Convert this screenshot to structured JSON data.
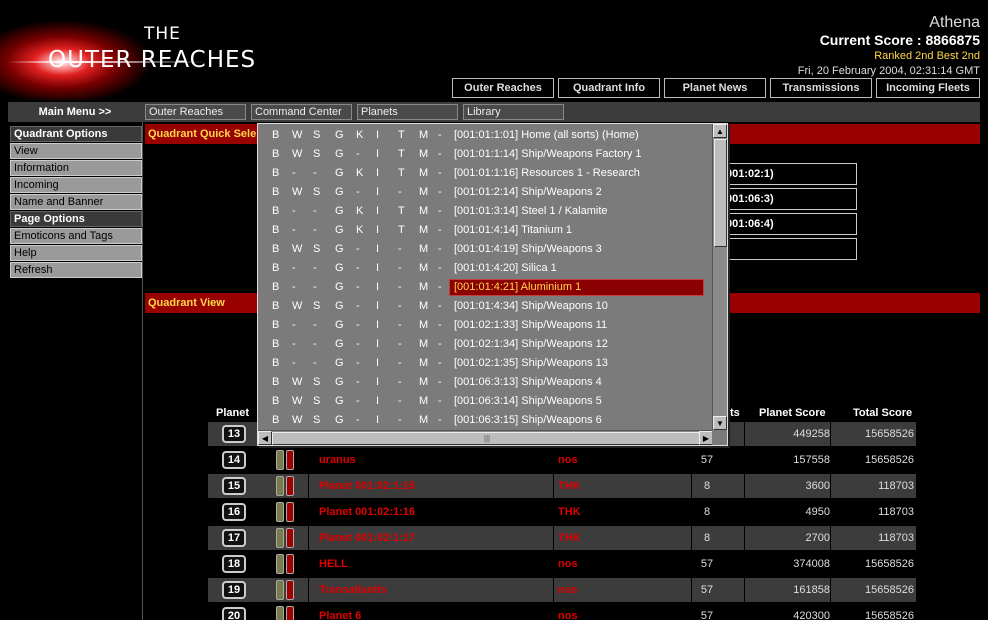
{
  "logo": {
    "the": "THE",
    "name": "OUTER REACHES"
  },
  "user": {
    "name": "Athena",
    "score": "Current Score : 8866875",
    "ranked": "Ranked 2nd Best 2nd",
    "datetime": "Fri, 20 February 2004, 02:31:14 GMT"
  },
  "top_nav": [
    "Outer Reaches",
    "Quadrant Info",
    "Planet News",
    "Transmissions",
    "Incoming Fleets"
  ],
  "menubar": {
    "main_menu": "Main Menu >>",
    "items": [
      "Outer Reaches",
      "Command Center",
      "Planets",
      "Library"
    ]
  },
  "sidebar": {
    "quadrant_options": "Quadrant Options",
    "quadrant_items": [
      "View",
      "Information",
      "Incoming",
      "Name and Banner"
    ],
    "page_options": "Page Options",
    "page_items": [
      "Emoticons and Tags",
      "Help",
      "Refresh"
    ]
  },
  "sections": {
    "quick_select": "Quadrant Quick Sele",
    "quadrant_view": "Quadrant View"
  },
  "quick_select_boxes": [
    "001:02:1)",
    "001:06:3)",
    "001:06:4)",
    ""
  ],
  "dropdown": {
    "selected_index": 8,
    "items": [
      {
        "f": [
          "B",
          "W",
          "S",
          "G",
          "K",
          "I",
          "T",
          "M",
          "-"
        ],
        "label": "[001:01:1:01] Home (all sorts) (Home)"
      },
      {
        "f": [
          "B",
          "W",
          "S",
          "G",
          "-",
          "I",
          "T",
          "M",
          "-"
        ],
        "label": "[001:01:1:14] Ship/Weapons Factory 1"
      },
      {
        "f": [
          "B",
          "-",
          "-",
          "G",
          "K",
          "I",
          "T",
          "M",
          "-"
        ],
        "label": "[001:01:1:16] Resources 1 - Research"
      },
      {
        "f": [
          "B",
          "W",
          "S",
          "G",
          "-",
          "I",
          "-",
          "M",
          "-"
        ],
        "label": "[001:01:2:14] Ship/Weapons 2"
      },
      {
        "f": [
          "B",
          "-",
          "-",
          "G",
          "K",
          "I",
          "T",
          "M",
          "-"
        ],
        "label": "[001:01:3:14] Steel 1 / Kalamite"
      },
      {
        "f": [
          "B",
          "-",
          "-",
          "G",
          "K",
          "I",
          "T",
          "M",
          "-"
        ],
        "label": "[001:01:4:14] Titanium 1"
      },
      {
        "f": [
          "B",
          "W",
          "S",
          "G",
          "-",
          "I",
          "-",
          "M",
          "-"
        ],
        "label": "[001:01:4:19] Ship/Weapons 3"
      },
      {
        "f": [
          "B",
          "-",
          "-",
          "G",
          "-",
          "I",
          "-",
          "M",
          "-"
        ],
        "label": "[001:01:4:20] Silica 1"
      },
      {
        "f": [
          "B",
          "-",
          "-",
          "G",
          "-",
          "I",
          "-",
          "M",
          "-"
        ],
        "label": "[001:01:4:21] Aluminium 1"
      },
      {
        "f": [
          "B",
          "W",
          "S",
          "G",
          "-",
          "I",
          "-",
          "M",
          "-"
        ],
        "label": "[001:01:4:34] Ship/Weapons 10"
      },
      {
        "f": [
          "B",
          "-",
          "-",
          "G",
          "-",
          "I",
          "-",
          "M",
          "-"
        ],
        "label": "[001:02:1:33] Ship/Weapons 11"
      },
      {
        "f": [
          "B",
          "-",
          "-",
          "G",
          "-",
          "I",
          "-",
          "M",
          "-"
        ],
        "label": "[001:02:1:34] Ship/Weapons 12"
      },
      {
        "f": [
          "B",
          "-",
          "-",
          "G",
          "-",
          "I",
          "-",
          "M",
          "-"
        ],
        "label": "[001:02:1:35] Ship/Weapons 13"
      },
      {
        "f": [
          "B",
          "W",
          "S",
          "G",
          "-",
          "I",
          "-",
          "M",
          "-"
        ],
        "label": "[001:06:3:13] Ship/Weapons 4"
      },
      {
        "f": [
          "B",
          "W",
          "S",
          "G",
          "-",
          "I",
          "-",
          "M",
          "-"
        ],
        "label": "[001:06:3:14] Ship/Weapons 5"
      },
      {
        "f": [
          "B",
          "W",
          "S",
          "G",
          "-",
          "I",
          "-",
          "M",
          "-"
        ],
        "label": "[001:06:3:15] Ship/Weapons 6"
      }
    ]
  },
  "table": {
    "headers": {
      "planet": "Planet",
      "rank_partial": "ts",
      "planet_score": "Planet Score",
      "total_score": "Total Score"
    },
    "rows": [
      {
        "num": "13",
        "name": "",
        "owner": "",
        "rank": "",
        "planet_score": "449258",
        "total_score": "15658526"
      },
      {
        "num": "14",
        "name": "uranus",
        "owner": "nos",
        "rank": "57",
        "planet_score": "157558",
        "total_score": "15658526"
      },
      {
        "num": "15",
        "name": "Planet 001:02:1:15",
        "owner": "THK",
        "rank": "8",
        "planet_score": "3600",
        "total_score": "118703"
      },
      {
        "num": "16",
        "name": "Planet 001:02:1:16",
        "owner": "THK",
        "rank": "8",
        "planet_score": "4950",
        "total_score": "118703"
      },
      {
        "num": "17",
        "name": "Planet 001:02:1:17",
        "owner": "THK",
        "rank": "8",
        "planet_score": "2700",
        "total_score": "118703"
      },
      {
        "num": "18",
        "name": "HELL",
        "owner": "nos",
        "rank": "57",
        "planet_score": "374008",
        "total_score": "15658526"
      },
      {
        "num": "19",
        "name": "Transatlantis",
        "owner": "nos",
        "rank": "57",
        "planet_score": "161858",
        "total_score": "15658526"
      },
      {
        "num": "20",
        "name": "Planet 6",
        "owner": "nos",
        "rank": "57",
        "planet_score": "420300",
        "total_score": "15658526"
      }
    ]
  }
}
